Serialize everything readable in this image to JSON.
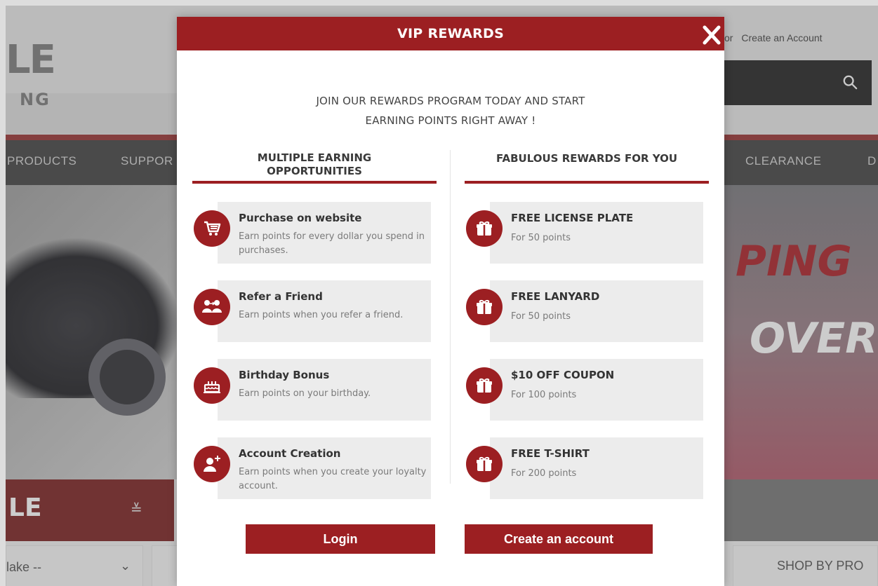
{
  "site": {
    "logo_text": "LE",
    "logo_sub": "NG",
    "account_or": "or",
    "create_account": "Create an Account",
    "nav": [
      "PRODUCTS",
      "SUPPOR",
      "CLEARANCE",
      "D"
    ],
    "promo_line1": "PING",
    "promo_line2": "OVER",
    "left_panel_text": "LE",
    "make_select": "lake --",
    "shop_by": "SHOP BY PRO"
  },
  "modal": {
    "title": "VIP REWARDS",
    "intro_line1": "JOIN OUR REWARDS PROGRAM TODAY AND START",
    "intro_line2": "EARNING POINTS RIGHT AWAY !",
    "earning": {
      "heading_line1": "MULTIPLE EARNING",
      "heading_line2": "OPPORTUNITIES",
      "items": [
        {
          "title": "Purchase on website",
          "desc": "Earn points for every dollar you spend in purchases.",
          "icon": "cart-icon"
        },
        {
          "title": "Refer a Friend",
          "desc": "Earn points when you refer a friend.",
          "icon": "refer-icon"
        },
        {
          "title": "Birthday Bonus",
          "desc": "Earn points on your birthday.",
          "icon": "cake-icon"
        },
        {
          "title": "Account Creation",
          "desc": "Earn points when you create your loyalty account.",
          "icon": "add-user-icon"
        }
      ]
    },
    "rewards": {
      "heading": "FABULOUS REWARDS FOR YOU",
      "items": [
        {
          "title": "FREE LICENSE PLATE",
          "desc": "For 50 points",
          "icon": "gift-icon"
        },
        {
          "title": "FREE LANYARD",
          "desc": "For 50 points",
          "icon": "gift-icon"
        },
        {
          "title": "$10 OFF COUPON",
          "desc": "For 100 points",
          "icon": "gift-icon"
        },
        {
          "title": "FREE T-SHIRT",
          "desc": "For 200 points",
          "icon": "gift-icon"
        }
      ]
    },
    "login_label": "Login",
    "create_label": "Create an account"
  },
  "colors": {
    "accent": "#9c1f22",
    "card_bg": "#ececec"
  }
}
